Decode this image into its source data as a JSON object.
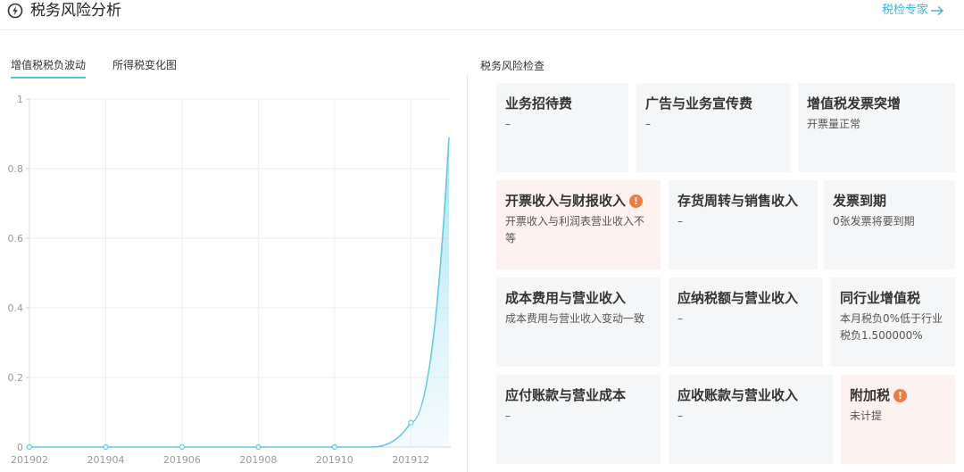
{
  "header": {
    "title": "税务风险分析",
    "expert_link": "税检专家"
  },
  "tabs": [
    {
      "label": "增值税税负波动",
      "active": true
    },
    {
      "label": "所得税变化图",
      "active": false
    }
  ],
  "chart_data": {
    "type": "area",
    "x": [
      "201902",
      "201903",
      "201904",
      "201905",
      "201906",
      "201907",
      "201908",
      "201909",
      "201910",
      "201911",
      "201912",
      "202001"
    ],
    "x_tick_labels": [
      "201902",
      "201904",
      "201906",
      "201908",
      "201910",
      "201912"
    ],
    "y_tick_labels": [
      "0",
      "0.2",
      "0.4",
      "0.6",
      "0.8",
      "1"
    ],
    "series": [
      {
        "values": [
          0,
          0,
          0,
          0,
          0,
          0,
          0,
          0,
          0,
          0,
          0.07,
          0.89
        ]
      }
    ],
    "ylim": [
      0,
      1
    ],
    "grid": true,
    "line_color": "#5ccbe6",
    "fill_color": "#dff4fb"
  },
  "risk_check": {
    "title": "税务风险检查",
    "rows": [
      [
        {
          "title": "业务招待费",
          "desc": "–",
          "warn": false
        },
        {
          "title": "广告与业务宣传费",
          "desc": "–",
          "warn": false
        },
        {
          "title": "增值税发票突增",
          "desc": "开票量正常",
          "warn": false
        }
      ],
      [
        {
          "title": "开票收入与财报收入",
          "desc": "开票收入与利润表营业收入不等",
          "warn": true
        },
        {
          "title": "存货周转与销售收入",
          "desc": "–",
          "warn": false
        },
        {
          "title": "发票到期",
          "desc": "0张发票将要到期",
          "warn": false
        }
      ],
      [
        {
          "title": "成本费用与营业收入",
          "desc": "成本费用与营业收入变动一致",
          "warn": false
        },
        {
          "title": "应纳税额与营业收入",
          "desc": "–",
          "warn": false
        },
        {
          "title": "同行业增值税",
          "desc": "本月税负0%低于行业税负1.500000%",
          "warn": false
        }
      ],
      [
        {
          "title": "应付账款与营业成本",
          "desc": "–",
          "warn": false
        },
        {
          "title": "应收账款与营业收入",
          "desc": "–",
          "warn": false
        },
        {
          "title": "附加税",
          "desc": "未计提",
          "warn": true
        }
      ]
    ],
    "warn_color": "#f07b3f"
  }
}
